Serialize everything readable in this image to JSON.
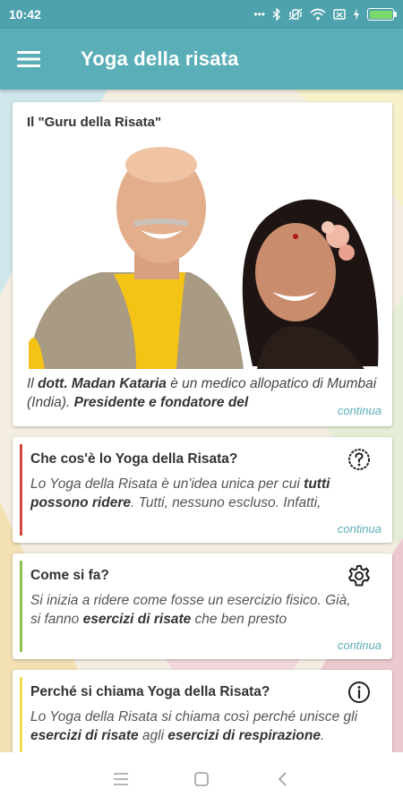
{
  "status_bar": {
    "time": "10:42",
    "icons": [
      "more-dots-icon",
      "bluetooth-icon",
      "vibrate-icon",
      "wifi-icon",
      "battery-saver-icon",
      "charging-icon",
      "battery-icon"
    ]
  },
  "app_bar": {
    "title": "Yoga della risata",
    "menu_icon": "hamburger-menu-icon"
  },
  "hero": {
    "title": "Il \"Guru della Risata\"",
    "image": "photo-madan-madhuri-kataria",
    "text_pre": "Il ",
    "text_b1": "dott. Madan Kataria",
    "text_mid": " è un medico allopatico di Mumbai (India). ",
    "text_b2": "Presidente e fondatore del",
    "link": "continua"
  },
  "sections": [
    {
      "title": "Che cos'è lo Yoga della Risata?",
      "icon": "question-circle-icon",
      "accent": "#d0453c",
      "text_pre": "Lo Yoga della Risata è un'idea unica per cui ",
      "text_b": "tutti possono ridere",
      "text_post": ". Tutti, nessuno escluso. Infatti,",
      "link": "continua"
    },
    {
      "title": "Come si fa?",
      "icon": "gear-icon",
      "accent": "#8cc152",
      "text_pre": "Si inizia a ridere come fosse un esercizio fisico. Già, si fanno ",
      "text_b": "esercizi di risate",
      "text_post": " che ben presto",
      "link": "continua"
    },
    {
      "title": "Perché si chiama Yoga della Risata?",
      "icon": "info-circle-icon",
      "accent": "#f2d94e",
      "text_pre": "Lo Yoga della Risata si chiama così perché unisce gli ",
      "text_b": "esercizi di risate",
      "text_mid": " agli ",
      "text_b2": "esercizi di respirazione",
      "text_post": "."
    }
  ],
  "nav_bar": {
    "buttons": [
      "recent-apps-icon",
      "home-icon",
      "back-icon"
    ]
  },
  "colors": {
    "primary": "#5aaeb7",
    "status_bar": "#4ea2ad",
    "link": "#5aaeb7"
  }
}
